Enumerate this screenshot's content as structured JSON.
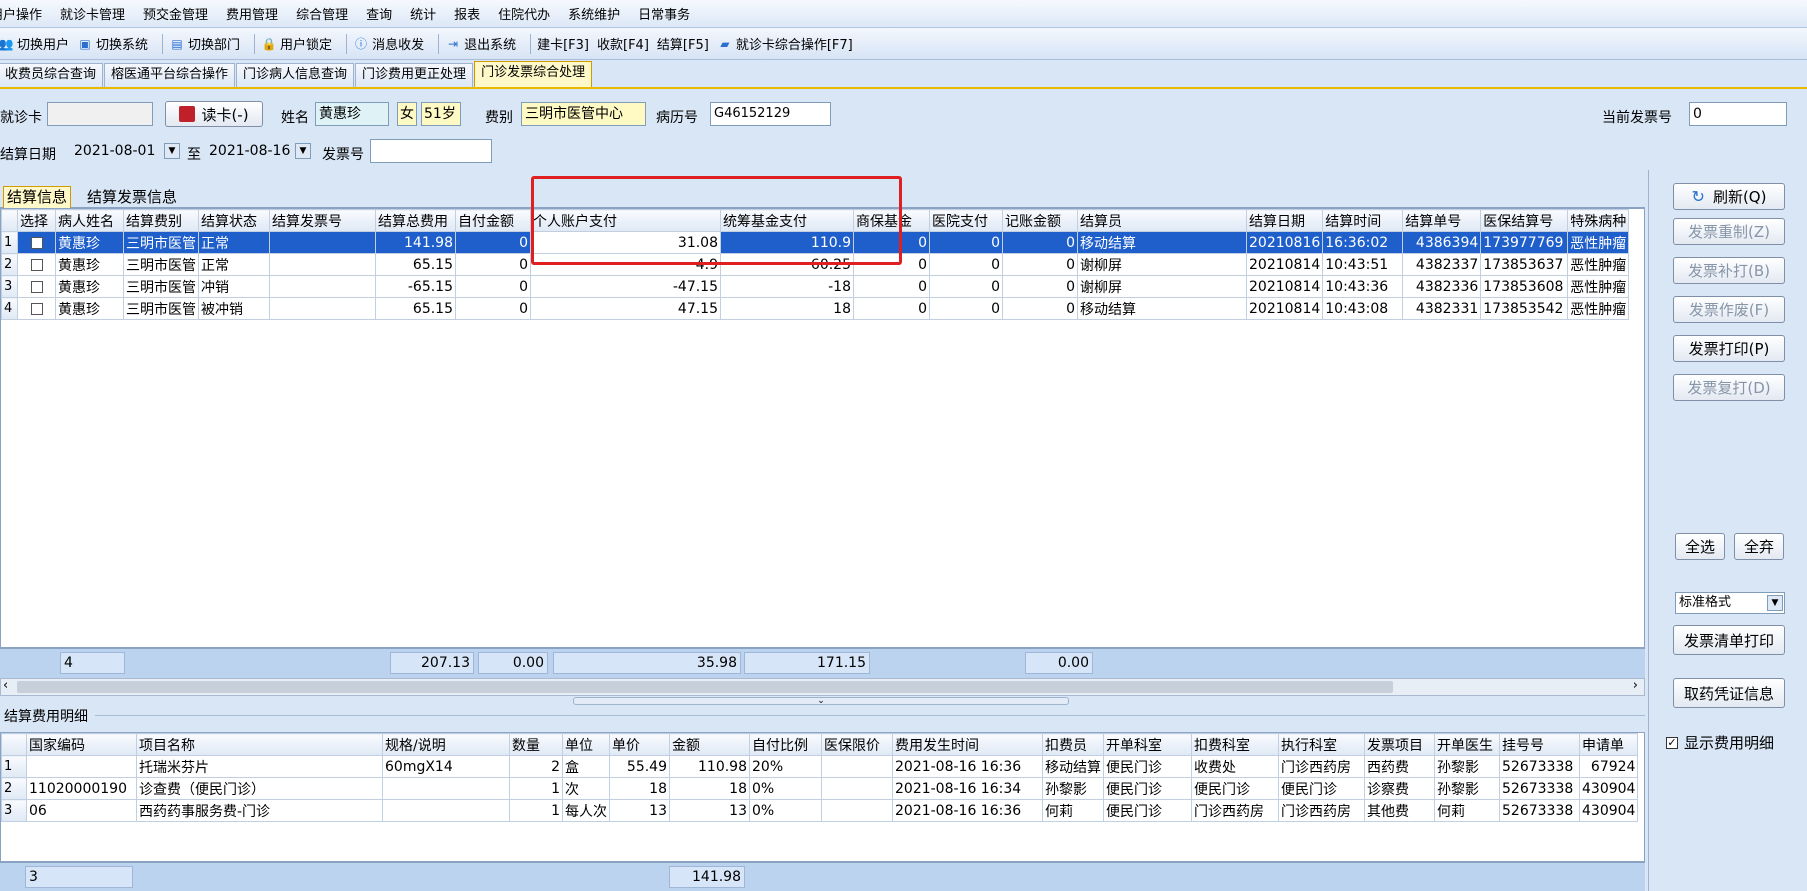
{
  "menu": [
    "用户操作",
    "就诊卡管理",
    "预交金管理",
    "费用管理",
    "综合管理",
    "查询",
    "统计",
    "报表",
    "住院代办",
    "系统维护",
    "日常事务"
  ],
  "toolbar": [
    {
      "label": "切换用户",
      "icon": "users-icon"
    },
    {
      "label": "切换系统",
      "icon": "switch-system-icon"
    },
    {
      "label": "切换部门",
      "icon": "department-icon"
    },
    {
      "label": "用户锁定",
      "icon": "user-lock-icon"
    },
    {
      "label": "消息收发",
      "icon": "info-icon"
    },
    {
      "label": "退出系统",
      "icon": "exit-icon"
    },
    {
      "label": "建卡[F3]",
      "icon": ""
    },
    {
      "label": "收款[F4]",
      "icon": ""
    },
    {
      "label": "结算[F5]",
      "icon": ""
    },
    {
      "label": "就诊卡综合操作[F7]",
      "icon": "card-icon"
    }
  ],
  "tabs": [
    "收费员综合查询",
    "榕医通平台综合操作",
    "门诊病人信息查询",
    "门诊费用更正处理",
    "门诊发票综合处理"
  ],
  "form": {
    "card_label": "就诊卡",
    "card_value": "",
    "read_card_button": "读卡(-)",
    "name_label": "姓名",
    "name_value": "黄惠珍",
    "sex_value": "女",
    "age_value": "51岁",
    "fee_type_label": "费别",
    "fee_type_value": "三明市医管中心",
    "record_label": "病历号",
    "record_value": "G46152129",
    "current_invoice_label": "当前发票号",
    "current_invoice_value": "0",
    "date_label": "结算日期",
    "date_from": "2021-08-01",
    "to_label": "至",
    "date_to": "2021-08-16",
    "invoice_no_label": "发票号",
    "invoice_no_value": ""
  },
  "settle_tabs": [
    "结算信息",
    "结算发票信息"
  ],
  "settle_table": {
    "headers": [
      "选择",
      "病人姓名",
      "结算费别",
      "结算状态",
      "结算发票号",
      "结算总费用",
      "自付金额",
      "个人账户支付",
      "统筹基金支付",
      "商保基金",
      "医院支付",
      "记账金额",
      "结算员",
      "结算日期",
      "结算时间",
      "结算单号",
      "医保结算号",
      "特殊病种"
    ],
    "rows": [
      [
        "",
        "黄惠珍",
        "三明市医管",
        "正常",
        "",
        "141.98",
        "0",
        "31.08",
        "110.9",
        "0",
        "0",
        "0",
        "移动结算",
        "20210816",
        "16:36:02",
        "4386394",
        "173977769",
        "恶性肿瘤"
      ],
      [
        "",
        "黄惠珍",
        "三明市医管",
        "正常",
        "",
        "65.15",
        "0",
        "4.9",
        "60.25",
        "0",
        "0",
        "0",
        "谢柳屏",
        "20210814",
        "10:43:51",
        "4382337",
        "173853637",
        "恶性肿瘤"
      ],
      [
        "",
        "黄惠珍",
        "三明市医管",
        "冲销",
        "",
        "-65.15",
        "0",
        "-47.15",
        "-18",
        "0",
        "0",
        "0",
        "谢柳屏",
        "20210814",
        "10:43:36",
        "4382336",
        "173853608",
        "恶性肿瘤"
      ],
      [
        "",
        "黄惠珍",
        "三明市医管",
        "被冲销",
        "",
        "65.15",
        "0",
        "47.15",
        "18",
        "0",
        "0",
        "0",
        "移动结算",
        "20210814",
        "10:43:08",
        "4382331",
        "173853542",
        "恶性肿瘤"
      ]
    ],
    "summary": {
      "count": "4",
      "total": "207.13",
      "self_pay": "0.00",
      "personal": "35.98",
      "pooled": "171.15",
      "account": "0.00"
    }
  },
  "detail_title": "结算费用明细",
  "detail_table": {
    "headers": [
      "国家编码",
      "项目名称",
      "规格/说明",
      "数量",
      "单位",
      "单价",
      "金额",
      "自付比例",
      "医保限价",
      "费用发生时间",
      "扣费员",
      "开单科室",
      "扣费科室",
      "执行科室",
      "发票项目",
      "开单医生",
      "挂号号",
      "申请单"
    ],
    "rows": [
      [
        "",
        "托瑞米芬片",
        "60mgX14",
        "2",
        "盒",
        "55.49",
        "110.98",
        "20%",
        "",
        "2021-08-16 16:36",
        "移动结算",
        "便民门诊",
        "收费处",
        "门诊西药房",
        "西药费",
        "孙黎影",
        "52673338",
        "67924"
      ],
      [
        "11020000190",
        "诊查费（便民门诊）",
        "",
        "1",
        "次",
        "18",
        "18",
        "0%",
        "",
        "2021-08-16 16:34",
        "孙黎影",
        "便民门诊",
        "便民门诊",
        "便民门诊",
        "诊察费",
        "孙黎影",
        "52673338",
        "430904"
      ],
      [
        "06",
        "西药药事服务费-门诊",
        "",
        "1",
        "每人次",
        "13",
        "13",
        "0%",
        "",
        "2021-08-16 16:36",
        "何莉",
        "便民门诊",
        "门诊西药房",
        "门诊西药房",
        "其他费",
        "何莉",
        "52673338",
        "430904"
      ]
    ],
    "summary": {
      "count": "3",
      "amount": "141.98"
    }
  },
  "side": {
    "refresh": "刷新(Q)",
    "reissue": "发票重制(Z)",
    "reprint": "发票补打(B)",
    "void": "发票作废(F)",
    "print": "发票打印(P)",
    "copy_print": "发票复打(D)",
    "select_all": "全选",
    "deselect_all": "全弃",
    "format": "标准格式",
    "list_print": "发票清单打印",
    "drug_voucher": "取药凭证信息",
    "show_detail": "显示费用明细"
  },
  "colors": {
    "highlight_box": "#e02020",
    "selection": "#1f5fcb",
    "tab_active": "#fff8c8",
    "summary_bar": "#bcd3f0"
  }
}
